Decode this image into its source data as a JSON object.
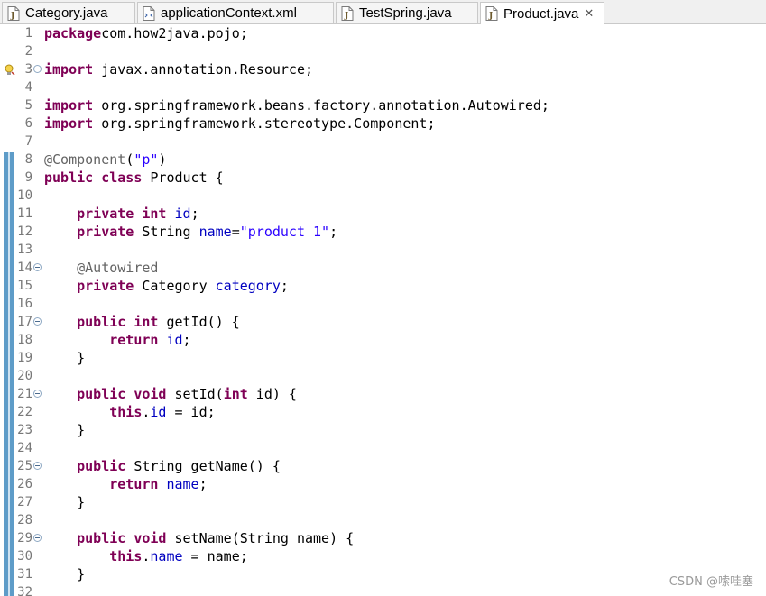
{
  "tabs": [
    {
      "label": "Category.java",
      "active": false
    },
    {
      "label": "applicationContext.xml",
      "active": false
    },
    {
      "label": "TestSpring.java",
      "active": false
    },
    {
      "label": "Product.java",
      "active": true,
      "close": "✕"
    }
  ],
  "icons": [
    "java-file-icon",
    "xml-file-icon",
    "warning-lightbulb-icon",
    "fold-collapse-icon"
  ],
  "colors": {
    "keyword": "#7f0055",
    "annotation": "#646464",
    "string": "#2a00ff",
    "field": "#0000c0",
    "change_ruler": "#5e9cc8"
  },
  "editor": {
    "lines": [
      {
        "n": "1",
        "tokens": [
          [
            "kw",
            "package"
          ],
          [
            "",
            "com.how2java.pojo;"
          ]
        ]
      },
      {
        "n": "2",
        "tokens": []
      },
      {
        "n": "3",
        "fold": true,
        "warn": true,
        "tokens": [
          [
            "kw",
            "import"
          ],
          [
            "",
            " javax.annotation.Resource;"
          ]
        ]
      },
      {
        "n": "4",
        "tokens": []
      },
      {
        "n": "5",
        "tokens": [
          [
            "kw",
            "import"
          ],
          [
            "",
            " org.springframework.beans.factory.annotation.Autowired;"
          ]
        ]
      },
      {
        "n": "6",
        "tokens": [
          [
            "kw",
            "import"
          ],
          [
            "",
            " org.springframework.stereotype.Component;"
          ]
        ]
      },
      {
        "n": "7",
        "tokens": []
      },
      {
        "n": "8",
        "tokens": [
          [
            "ann",
            "@Component"
          ],
          [
            "",
            "("
          ],
          [
            "str",
            "\"p\""
          ],
          [
            "",
            ")"
          ]
        ]
      },
      {
        "n": "9",
        "tokens": [
          [
            "kw",
            "public class"
          ],
          [
            "",
            " Product {"
          ]
        ]
      },
      {
        "n": "10",
        "tokens": []
      },
      {
        "n": "11",
        "tokens": [
          [
            "",
            "    "
          ],
          [
            "kw",
            "private int"
          ],
          [
            "",
            " "
          ],
          [
            "fld",
            "id"
          ],
          [
            "",
            ";"
          ]
        ]
      },
      {
        "n": "12",
        "tokens": [
          [
            "",
            "    "
          ],
          [
            "kw",
            "private"
          ],
          [
            "",
            " String "
          ],
          [
            "fld",
            "name"
          ],
          [
            "",
            "="
          ],
          [
            "str",
            "\"product 1\""
          ],
          [
            "",
            ";"
          ]
        ]
      },
      {
        "n": "13",
        "tokens": []
      },
      {
        "n": "14",
        "fold": true,
        "tokens": [
          [
            "",
            "    "
          ],
          [
            "ann",
            "@Autowired"
          ]
        ]
      },
      {
        "n": "15",
        "tokens": [
          [
            "",
            "    "
          ],
          [
            "kw",
            "private"
          ],
          [
            "",
            " Category "
          ],
          [
            "fld",
            "category"
          ],
          [
            "",
            ";"
          ]
        ]
      },
      {
        "n": "16",
        "tokens": []
      },
      {
        "n": "17",
        "fold": true,
        "tokens": [
          [
            "",
            "    "
          ],
          [
            "kw",
            "public int"
          ],
          [
            "",
            " getId() {"
          ]
        ]
      },
      {
        "n": "18",
        "tokens": [
          [
            "",
            "        "
          ],
          [
            "kw",
            "return"
          ],
          [
            "",
            " "
          ],
          [
            "fld",
            "id"
          ],
          [
            "",
            ";"
          ]
        ]
      },
      {
        "n": "19",
        "tokens": [
          [
            "",
            "    }"
          ]
        ]
      },
      {
        "n": "20",
        "tokens": []
      },
      {
        "n": "21",
        "fold": true,
        "tokens": [
          [
            "",
            "    "
          ],
          [
            "kw",
            "public void"
          ],
          [
            "",
            " setId("
          ],
          [
            "kw",
            "int"
          ],
          [
            "",
            " id) {"
          ]
        ]
      },
      {
        "n": "22",
        "tokens": [
          [
            "",
            "        "
          ],
          [
            "kw",
            "this"
          ],
          [
            "",
            "."
          ],
          [
            "fld",
            "id"
          ],
          [
            "",
            " = id;"
          ]
        ]
      },
      {
        "n": "23",
        "tokens": [
          [
            "",
            "    }"
          ]
        ]
      },
      {
        "n": "24",
        "tokens": []
      },
      {
        "n": "25",
        "fold": true,
        "tokens": [
          [
            "",
            "    "
          ],
          [
            "kw",
            "public"
          ],
          [
            "",
            " String getName() {"
          ]
        ]
      },
      {
        "n": "26",
        "tokens": [
          [
            "",
            "        "
          ],
          [
            "kw",
            "return"
          ],
          [
            "",
            " "
          ],
          [
            "fld",
            "name"
          ],
          [
            "",
            ";"
          ]
        ]
      },
      {
        "n": "27",
        "tokens": [
          [
            "",
            "    }"
          ]
        ]
      },
      {
        "n": "28",
        "tokens": []
      },
      {
        "n": "29",
        "fold": true,
        "tokens": [
          [
            "",
            "    "
          ],
          [
            "kw",
            "public void"
          ],
          [
            "",
            " setName(String name) {"
          ]
        ]
      },
      {
        "n": "30",
        "tokens": [
          [
            "",
            "        "
          ],
          [
            "kw",
            "this"
          ],
          [
            "",
            "."
          ],
          [
            "fld",
            "name"
          ],
          [
            "",
            " = name;"
          ]
        ]
      },
      {
        "n": "31",
        "tokens": [
          [
            "",
            "    }"
          ]
        ]
      },
      {
        "n": "32",
        "tokens": []
      }
    ]
  },
  "watermark": "CSDN @嗦哇塞"
}
